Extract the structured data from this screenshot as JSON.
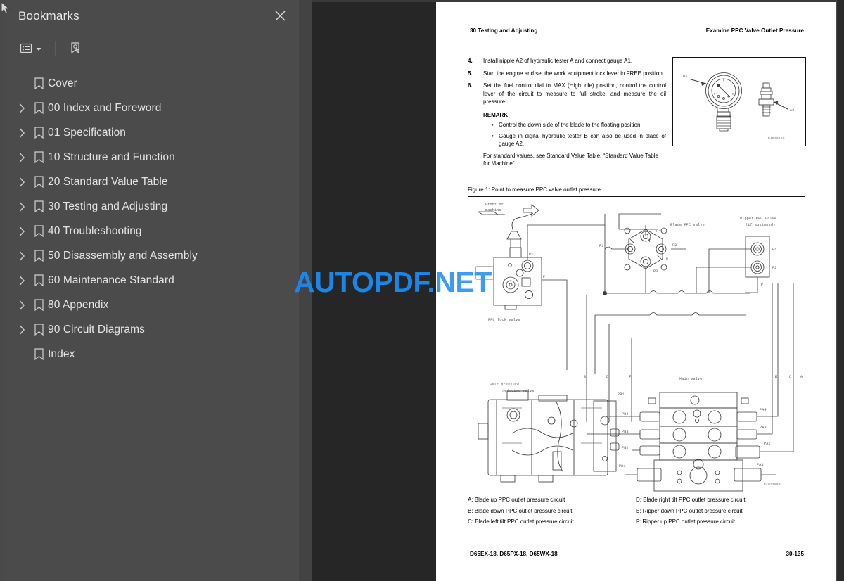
{
  "sidebar": {
    "title": "Bookmarks",
    "close_label": "close-icon",
    "toolbar": {
      "list_options_label": "list-options",
      "expand_label": "find-bookmark"
    },
    "items": [
      {
        "label": "Cover",
        "expandable": false
      },
      {
        "label": "00 Index and Foreword",
        "expandable": true
      },
      {
        "label": "01 Specification",
        "expandable": true
      },
      {
        "label": "10 Structure and Function",
        "expandable": true
      },
      {
        "label": "20 Standard Value Table",
        "expandable": true
      },
      {
        "label": "30 Testing and Adjusting",
        "expandable": true
      },
      {
        "label": "40 Troubleshooting",
        "expandable": true
      },
      {
        "label": "50 Disassembly and Assembly",
        "expandable": true
      },
      {
        "label": "60 Maintenance Standard",
        "expandable": true
      },
      {
        "label": "80 Appendix",
        "expandable": true
      },
      {
        "label": "90 Circuit Diagrams",
        "expandable": true
      },
      {
        "label": "Index",
        "expandable": false
      }
    ]
  },
  "watermark": {
    "part1": "AUTOPDF.",
    "part2": "NET",
    "color1": "#1b86e8",
    "color2": "#3d9bf0"
  },
  "page": {
    "header": {
      "left": "30 Testing and Adjusting",
      "right": "Examine PPC Valve Outlet Pressure"
    },
    "steps": [
      {
        "num": "4.",
        "text": "Install nipple A2 of hydraulic tester A and connect gauge A1."
      },
      {
        "num": "5.",
        "text": "Start the engine and set the work equipment lock lever in FREE position."
      },
      {
        "num": "6.",
        "text": "Set the fuel control dial to MAX (High idle) position, control the control lever of the circuit to measure to full stroke, and measure the oil pressure."
      }
    ],
    "remark_heading": "REMARK",
    "remark_bullets": [
      "Control the down side of the blade to the floating position.",
      "Gauge in digital hydraulic tester B can also be used in place of gauge A2."
    ],
    "standard_note": "For standard values, see Standard Value Table, “Standard Value Table for Machine”.",
    "figure_caption": "Figure 1: Point to measure PPC valve outlet pressure",
    "top_figure": {
      "label_a1": "A1",
      "label_a2": "A2",
      "drawing_code": "B4P30869"
    },
    "main_figure": {
      "drawing_code": "B4D23690",
      "labels": {
        "front_of_machine_1": "Front of",
        "front_of_machine_2": "machine",
        "ppc_lock_valve": "PPC lock valve",
        "blade_ppc_valve": "Blade PPC valve",
        "ripper_ppc_valve_1": "Ripper PPC valve",
        "ripper_ppc_valve_2": "(if equipped)",
        "self_pressure_1": "Self pressure",
        "self_pressure_2": "reducing valve",
        "main_valve": "Main valve"
      },
      "ports": [
        "P1",
        "P",
        "P2",
        "P3",
        "P4",
        "T",
        "PR1",
        "PB4",
        "PB3",
        "PB2",
        "PB1",
        "PA4",
        "PA3",
        "PA2",
        "PA1"
      ],
      "circuit_markers": [
        "B",
        "D",
        "F",
        "E",
        "C",
        "A"
      ]
    },
    "legend_left": [
      "A: Blade up PPC outlet pressure circuit",
      "B: Blade down PPC outlet pressure circuit",
      "C: Blade left tilt PPC outlet pressure circuit"
    ],
    "legend_right": [
      "D: Blade right tilt PPC outlet pressure circuit",
      "E: Ripper down PPC outlet pressure circuit",
      "F: Ripper up PPC outlet pressure circuit"
    ],
    "footer": {
      "left": "D65EX-18, D65PX-18, D65WX-18",
      "right": "30-135"
    }
  }
}
